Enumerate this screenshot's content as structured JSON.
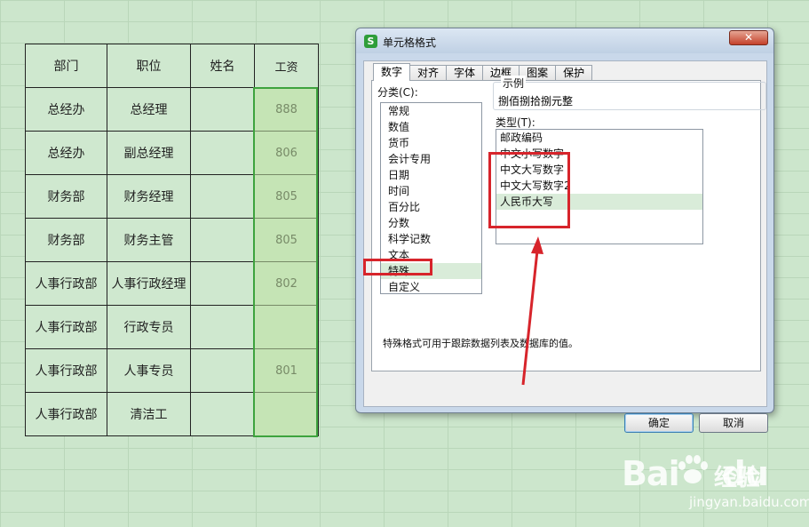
{
  "table": {
    "headers": [
      "部门",
      "职位",
      "姓名",
      "工资"
    ],
    "rows": [
      [
        "总经办",
        "总经理",
        "",
        "888"
      ],
      [
        "总经办",
        "副总经理",
        "",
        "806"
      ],
      [
        "财务部",
        "财务经理",
        "",
        "805"
      ],
      [
        "财务部",
        "财务主管",
        "",
        "805"
      ],
      [
        "人事行政部",
        "人事行政经理",
        "",
        "802"
      ],
      [
        "人事行政部",
        "行政专员",
        "",
        ""
      ],
      [
        "人事行政部",
        "人事专员",
        "",
        "801"
      ],
      [
        "人事行政部",
        "清洁工",
        "",
        ""
      ]
    ]
  },
  "dialog": {
    "title": "单元格格式",
    "app_icon_glyph": "S",
    "close_glyph": "✕",
    "tabs": [
      "数字",
      "对齐",
      "字体",
      "边框",
      "图案",
      "保护"
    ],
    "active_tab": 0,
    "category_label": "分类(C):",
    "categories": [
      "常规",
      "数值",
      "货币",
      "会计专用",
      "日期",
      "时间",
      "百分比",
      "分数",
      "科学记数",
      "文本",
      "特殊",
      "自定义"
    ],
    "selected_category": 10,
    "sample_label": "示例",
    "sample_value": "捌佰捌拾捌元整",
    "type_label": "类型(T):",
    "types": [
      "邮政编码",
      "中文小写数字",
      "中文大写数字",
      "中文大写数字2",
      "人民币大写"
    ],
    "selected_type": 4,
    "description": "特殊格式可用于跟踪数据列表及数据库的值。",
    "ok_label": "确定",
    "cancel_label": "取消"
  },
  "annotation_color": "#d7242b",
  "selection_color": "#3ea33e",
  "watermark": {
    "logo": "Bai",
    "logo_tail": "du",
    "brand": "经验",
    "url": "jingyan.baidu.com"
  }
}
